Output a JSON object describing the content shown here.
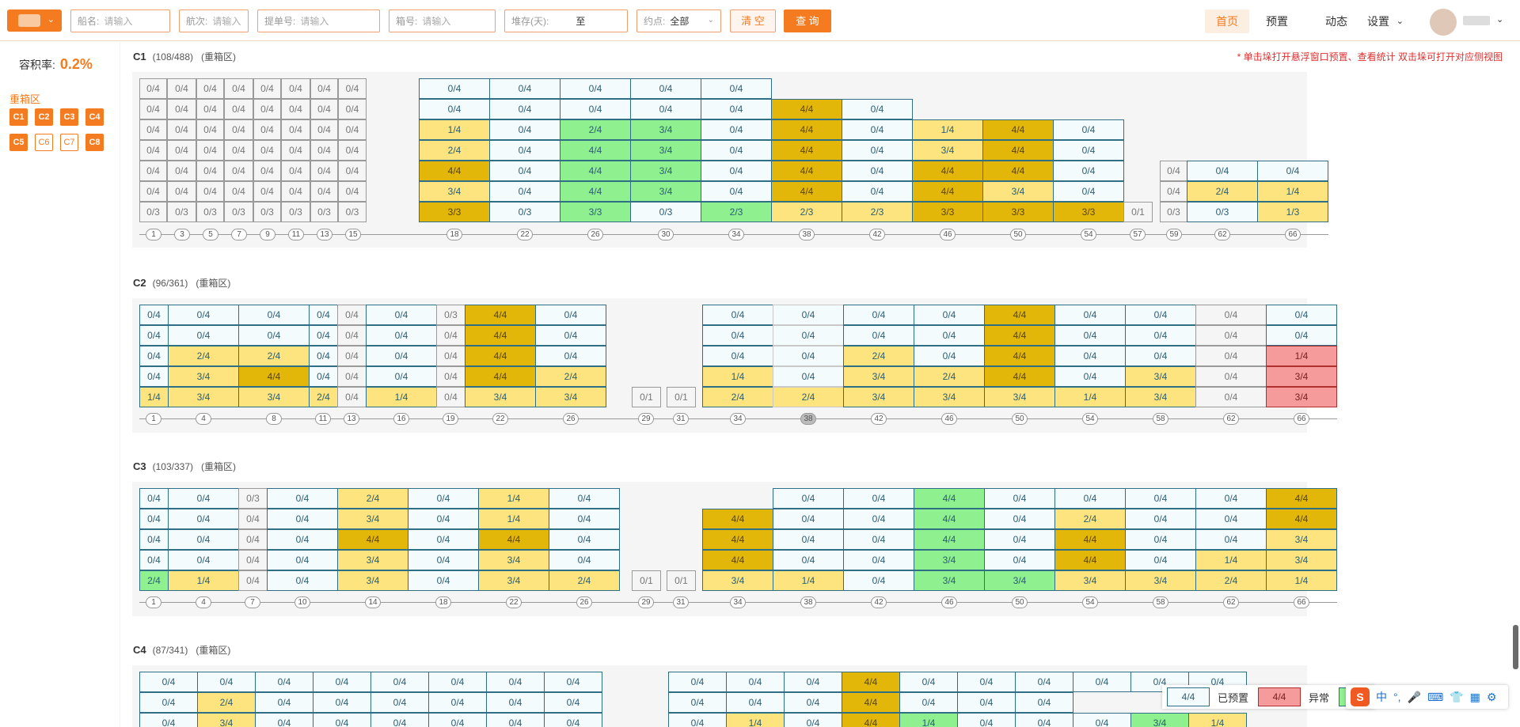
{
  "topbar": {
    "ship_label": "船名:",
    "ship_ph": "请输入",
    "voyage_label": "航次:",
    "voyage_ph": "请输入",
    "bl_label": "提单号:",
    "bl_ph": "请输入",
    "box_label": "箱号:",
    "box_ph": "请输入",
    "stack_label": "堆存(天):",
    "stack_to": "至",
    "yue_label": "约点:",
    "yue_val": "全部",
    "clear": "清 空",
    "query": "查 询",
    "nav": [
      "首页",
      "预置",
      "动态",
      "设置"
    ]
  },
  "sidebar": {
    "rate_label": "容积率:",
    "rate_value": "0.2%",
    "zone_title": "重箱区",
    "zones": [
      "C1",
      "C2",
      "C3",
      "C4",
      "C5",
      "C6",
      "C7",
      "C8"
    ]
  },
  "hint": "* 单击垛打开悬浮窗口预置、查看统计 双击垛可打开对应侧视图",
  "sections": [
    {
      "name": "C1",
      "count": "(108/488)",
      "type": "(重箱区)"
    },
    {
      "name": "C2",
      "count": "(96/361)",
      "type": "(重箱区)"
    },
    {
      "name": "C3",
      "count": "(103/337)",
      "type": "(重箱区)"
    },
    {
      "name": "C4",
      "count": "(87/341)",
      "type": "(重箱区)"
    }
  ],
  "legend": {
    "preset_value": "4/4",
    "preset_label": "已预置",
    "abnormal_value": "4/4",
    "abnormal_label": "异常"
  },
  "ime": {
    "logo": "S",
    "lang": "中",
    "punct": "°,"
  }
}
